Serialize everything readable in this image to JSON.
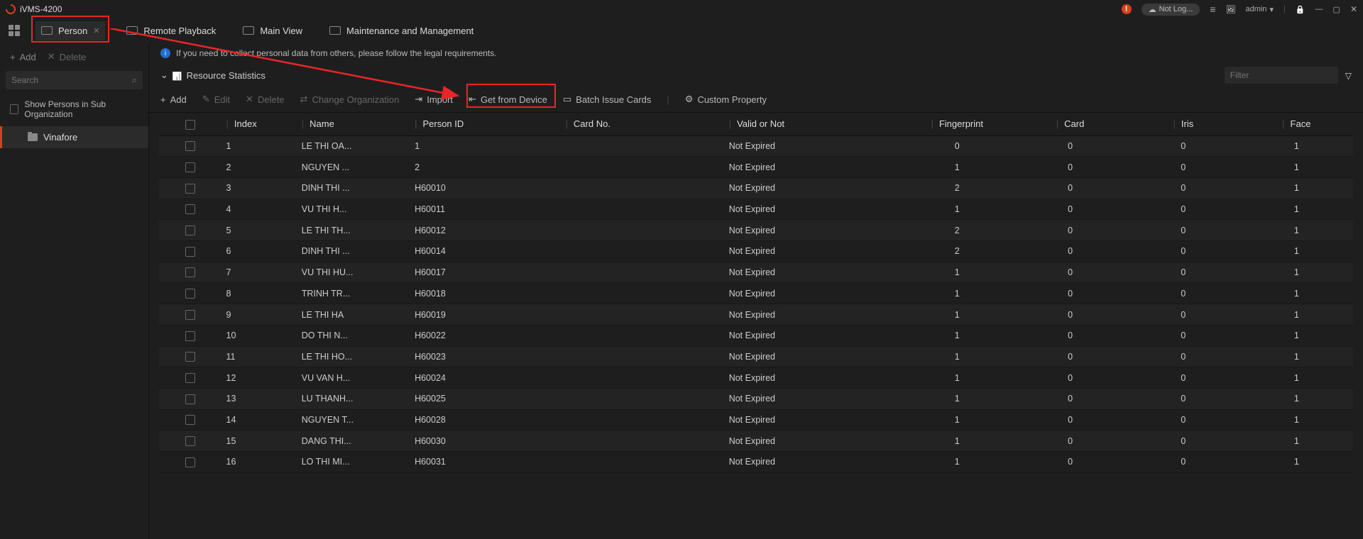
{
  "app": {
    "title": "iVMS-4200"
  },
  "titlebar": {
    "not_logged": "Not Log...",
    "admin": "admin"
  },
  "tabs": {
    "person": "Person",
    "remote_playback": "Remote Playback",
    "main_view": "Main View",
    "maintenance": "Maintenance and Management"
  },
  "side": {
    "add": "Add",
    "delete": "Delete",
    "search_placeholder": "Search",
    "show_sub": "Show Persons in Sub Organization",
    "org": "Vinafore"
  },
  "notice": "If you need to collect personal data from others, please follow the legal requirements.",
  "stats_label": "Resource Statistics",
  "filter_placeholder": "Filter",
  "toolbar": {
    "add": "Add",
    "edit": "Edit",
    "delete": "Delete",
    "change_org": "Change Organization",
    "import": "Import",
    "get_from_device": "Get from Device",
    "batch_issue": "Batch Issue Cards",
    "custom_prop": "Custom Property"
  },
  "cols": {
    "index": "Index",
    "name": "Name",
    "person_id": "Person ID",
    "card_no": "Card No.",
    "valid": "Valid or Not",
    "fingerprint": "Fingerprint",
    "card": "Card",
    "iris": "Iris",
    "face": "Face"
  },
  "rows": [
    {
      "index": "1",
      "name": "LE THI OA...",
      "pid": "1",
      "card": "",
      "valid": "Not Expired",
      "fp": "0",
      "cd": "0",
      "iris": "0",
      "face": "1"
    },
    {
      "index": "2",
      "name": "NGUYEN ...",
      "pid": "2",
      "card": "",
      "valid": "Not Expired",
      "fp": "1",
      "cd": "0",
      "iris": "0",
      "face": "1"
    },
    {
      "index": "3",
      "name": "DINH THI ...",
      "pid": "H60010",
      "card": "",
      "valid": "Not Expired",
      "fp": "2",
      "cd": "0",
      "iris": "0",
      "face": "1"
    },
    {
      "index": "4",
      "name": "VU THI H...",
      "pid": "H60011",
      "card": "",
      "valid": "Not Expired",
      "fp": "1",
      "cd": "0",
      "iris": "0",
      "face": "1"
    },
    {
      "index": "5",
      "name": "LE THI TH...",
      "pid": "H60012",
      "card": "",
      "valid": "Not Expired",
      "fp": "2",
      "cd": "0",
      "iris": "0",
      "face": "1"
    },
    {
      "index": "6",
      "name": "DINH THI ...",
      "pid": "H60014",
      "card": "",
      "valid": "Not Expired",
      "fp": "2",
      "cd": "0",
      "iris": "0",
      "face": "1"
    },
    {
      "index": "7",
      "name": "VU THI HU...",
      "pid": "H60017",
      "card": "",
      "valid": "Not Expired",
      "fp": "1",
      "cd": "0",
      "iris": "0",
      "face": "1"
    },
    {
      "index": "8",
      "name": "TRINH TR...",
      "pid": "H60018",
      "card": "",
      "valid": "Not Expired",
      "fp": "1",
      "cd": "0",
      "iris": "0",
      "face": "1"
    },
    {
      "index": "9",
      "name": "LE THI HA",
      "pid": "H60019",
      "card": "",
      "valid": "Not Expired",
      "fp": "1",
      "cd": "0",
      "iris": "0",
      "face": "1"
    },
    {
      "index": "10",
      "name": "DO THI N...",
      "pid": "H60022",
      "card": "",
      "valid": "Not Expired",
      "fp": "1",
      "cd": "0",
      "iris": "0",
      "face": "1"
    },
    {
      "index": "11",
      "name": "LE THI HO...",
      "pid": "H60023",
      "card": "",
      "valid": "Not Expired",
      "fp": "1",
      "cd": "0",
      "iris": "0",
      "face": "1"
    },
    {
      "index": "12",
      "name": "VU VAN H...",
      "pid": "H60024",
      "card": "",
      "valid": "Not Expired",
      "fp": "1",
      "cd": "0",
      "iris": "0",
      "face": "1"
    },
    {
      "index": "13",
      "name": "LU THANH...",
      "pid": "H60025",
      "card": "",
      "valid": "Not Expired",
      "fp": "1",
      "cd": "0",
      "iris": "0",
      "face": "1"
    },
    {
      "index": "14",
      "name": "NGUYEN T...",
      "pid": "H60028",
      "card": "",
      "valid": "Not Expired",
      "fp": "1",
      "cd": "0",
      "iris": "0",
      "face": "1"
    },
    {
      "index": "15",
      "name": "DANG THI...",
      "pid": "H60030",
      "card": "",
      "valid": "Not Expired",
      "fp": "1",
      "cd": "0",
      "iris": "0",
      "face": "1"
    },
    {
      "index": "16",
      "name": "LO THI MI...",
      "pid": "H60031",
      "card": "",
      "valid": "Not Expired",
      "fp": "1",
      "cd": "0",
      "iris": "0",
      "face": "1"
    }
  ]
}
